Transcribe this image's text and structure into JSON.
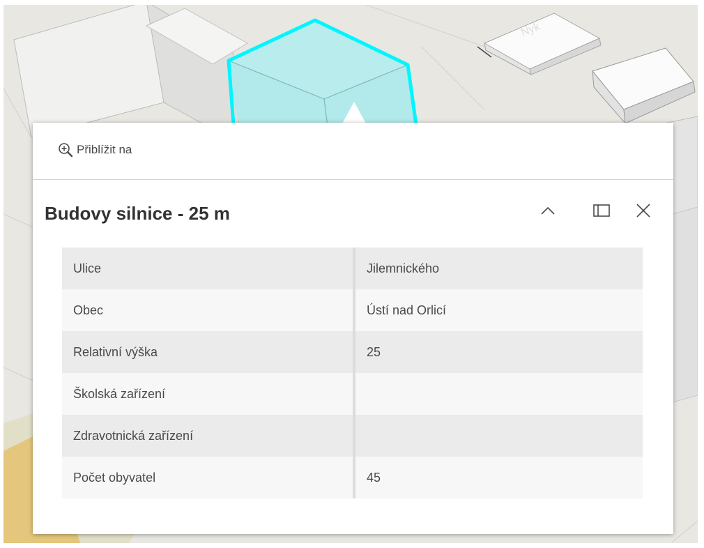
{
  "popup": {
    "zoom_action_label": "Přiblížit na",
    "title": "Budovy silnice - 25 m",
    "buttons": {
      "collapse_icon": "chevron-up-icon",
      "dock_icon": "dock-panel-icon",
      "close_icon": "close-icon"
    },
    "fields": [
      {
        "label": "Ulice",
        "value": "Jilemnického"
      },
      {
        "label": "Obec",
        "value": "Ústí nad Orlicí"
      },
      {
        "label": "Relativní výška",
        "value": "25"
      },
      {
        "label": "Školská zařízení",
        "value": ""
      },
      {
        "label": "Zdravotnická zařízení",
        "value": ""
      },
      {
        "label": "Počet obyvatel",
        "value": "45"
      }
    ]
  },
  "map": {
    "highlight_fill": "#b2e9ea",
    "highlight_outline": "#00f5ff",
    "background": "#e9e8e3"
  }
}
